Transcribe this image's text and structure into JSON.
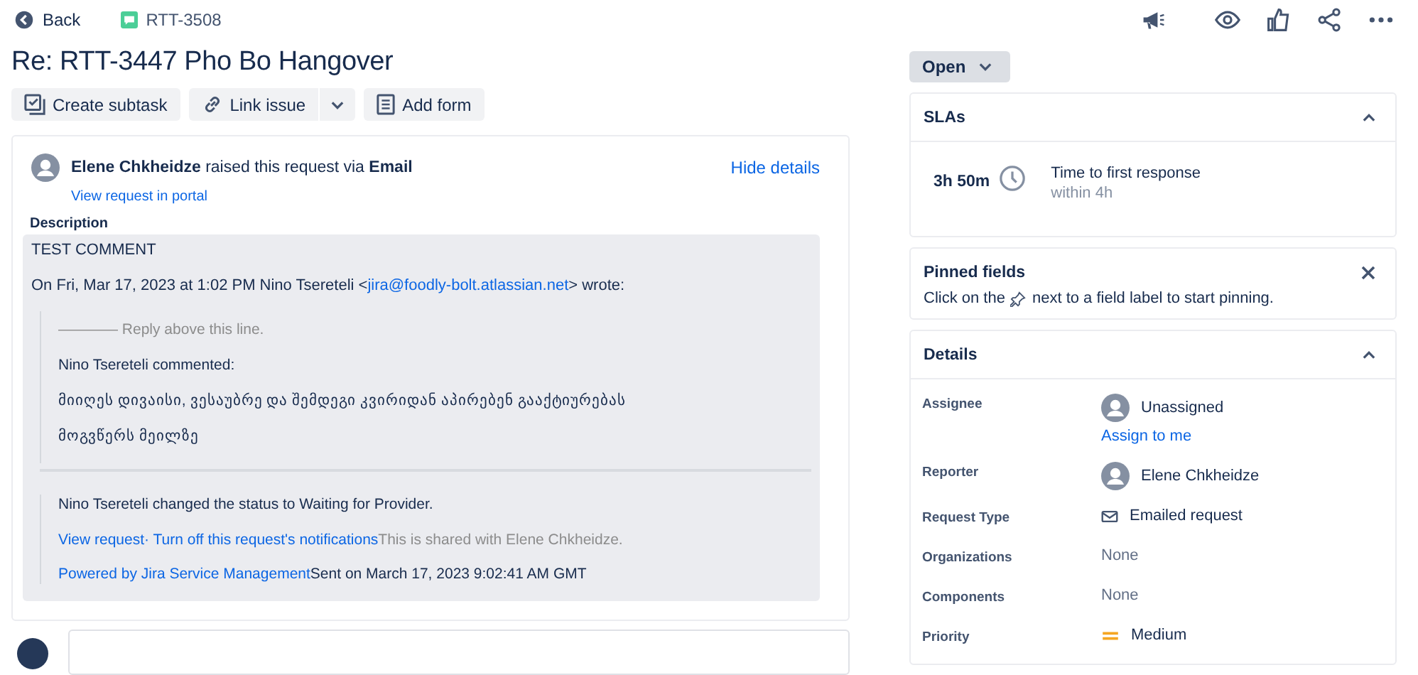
{
  "topbar": {
    "back": "Back",
    "issue_key": "RTT-3508"
  },
  "title": "Re: RTT-3447 Pho Bo Hangover",
  "toolbar": [
    {
      "label": "Create subtask",
      "kind": "subtask"
    },
    {
      "label": "Link issue",
      "kind": "link"
    },
    {
      "label": "Add form",
      "kind": "form"
    }
  ],
  "request": {
    "reporter": "Elene Chkheidze",
    "action": "raised this request via",
    "channel": "Email",
    "portal_link": "View request in portal",
    "hide": "Hide details",
    "description_label": "Description",
    "lines": [
      {
        "kind": "text",
        "text": "TEST COMMENT"
      },
      {
        "kind": "mail",
        "before": "On Fri, Mar 17, 2023 at 1:02 PM Nino Tsereteli <",
        "link": "jira@foodly-bolt.atlassian.net",
        "after": "> wrote:"
      },
      {
        "kind": "quote",
        "lines": [
          {
            "kind": "muted",
            "text": "———— Reply above this line."
          },
          {
            "kind": "text",
            "text": "Nino Tsereteli commented:"
          },
          {
            "kind": "text",
            "text": "მიიღეს დივაისი, ვესაუბრე და შემდეგი კვირიდან აპირებენ გააქტიურებას"
          },
          {
            "kind": "text",
            "text": "მოგვწერს მეილზე"
          }
        ]
      },
      {
        "kind": "rule"
      },
      {
        "kind": "quote",
        "lines": [
          {
            "kind": "text",
            "text": "Nino Tsereteli changed the status to Waiting for Provider."
          },
          {
            "kind": "links",
            "links": [
              "View request",
              "· Turn off this request's notifications"
            ],
            "after": "This is shared with Elene Chkheidze.",
            "muted": true
          },
          {
            "kind": "links",
            "links": [
              "Powered by Jira Service Management"
            ],
            "after": "Sent on March 17, 2023 9:02:41 AM GMT",
            "muted": false
          }
        ]
      }
    ]
  },
  "status": "Open",
  "slas": {
    "title": "SLAs",
    "expanded": true,
    "time": "3h 50m",
    "goal": "Time to first response",
    "within": "within 4h"
  },
  "pinned": {
    "title": "Pinned fields",
    "before": "Click on the",
    "after": "next to a field label to start pinning."
  },
  "details": {
    "title": "Details",
    "expanded": true,
    "fields": [
      {
        "label": "Assignee",
        "kind": "person",
        "value": "Unassigned",
        "action": "Assign to me"
      },
      {
        "label": "Reporter",
        "kind": "person",
        "value": "Elene Chkheidze"
      },
      {
        "label": "Request Type",
        "kind": "mail",
        "value": "Emailed request"
      },
      {
        "label": "Organizations",
        "kind": "none",
        "value": "None"
      },
      {
        "label": "Components",
        "kind": "none",
        "value": "None"
      },
      {
        "label": "Priority",
        "kind": "priority",
        "value": "Medium"
      }
    ]
  }
}
